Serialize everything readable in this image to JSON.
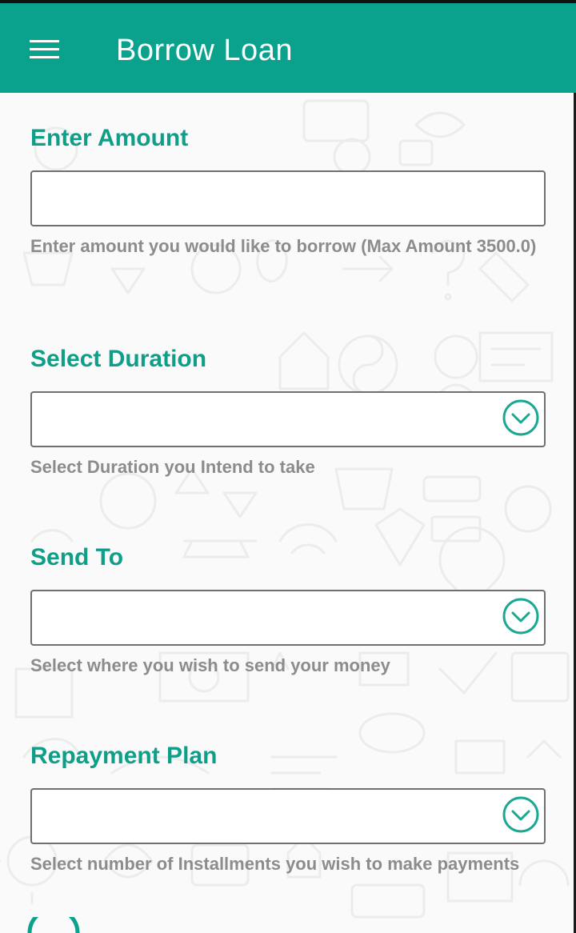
{
  "app_bar": {
    "title": "Borrow Loan",
    "menu_icon": "hamburger-menu-icon",
    "background_color": "#0aa18d"
  },
  "form": {
    "amount": {
      "label": "Enter Amount",
      "value": "",
      "hint": "Enter amount you would like to borrow (Max Amount 3500.0)"
    },
    "duration": {
      "label": "Select Duration",
      "selected": "",
      "hint": "Select Duration you Intend to take",
      "icon": "chevron-down-circle-icon"
    },
    "send_to": {
      "label": "Send To",
      "selected": "",
      "hint": "Select where you wish to send your money",
      "icon": "chevron-down-circle-icon"
    },
    "repayment_plan": {
      "label": "Repayment Plan",
      "selected": "",
      "hint": "Select number of Installments you wish to make payments",
      "icon": "chevron-down-circle-icon"
    }
  },
  "colors": {
    "accent": "#0f9e88",
    "hint_text": "#8c8c8c",
    "field_border": "#6f6f6f"
  }
}
